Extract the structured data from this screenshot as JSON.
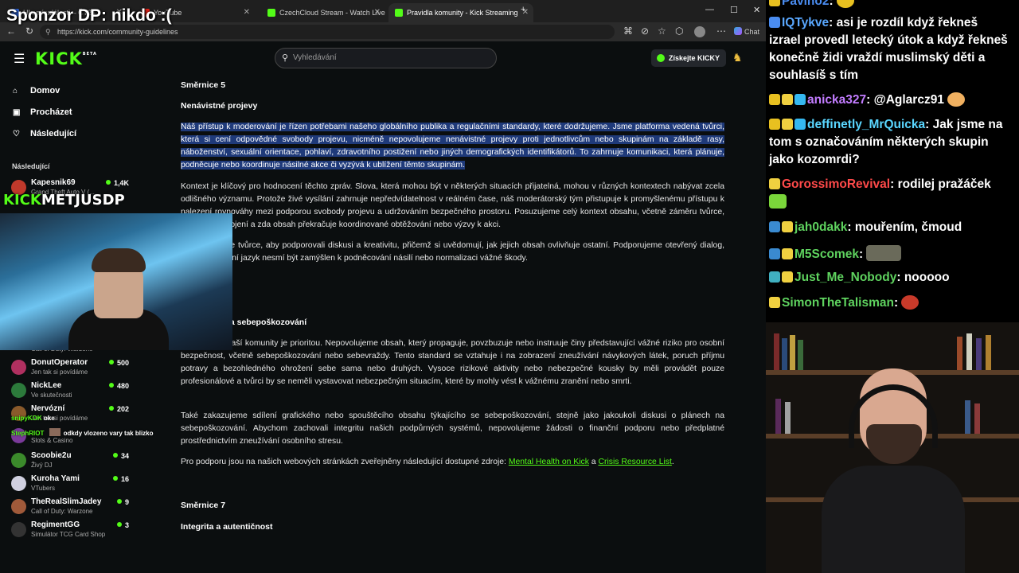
{
  "overlay": {
    "sponsor": "Sponzor DP: nikdo :(",
    "watermark_kick": "KICK",
    "watermark_name": "METJUSDP",
    "chat_line_user1": "snipyKOK",
    "chat_line_text1": "oke",
    "chat_line_user2": "StephRIOT",
    "chat_line_text2": "odkdy vlozeno vary tak blizko"
  },
  "browser": {
    "tabs": [
      {
        "label": "Hlavní události – ČT24"
      },
      {
        "label": "CzechCloud Stream - Watch Live o"
      },
      {
        "label": "Pravidla komunity - Kick Streaming"
      }
    ],
    "tab_youtube": "YouTube",
    "url": "https://kick.com/community-guidelines",
    "chat_btn": "Chat"
  },
  "kick": {
    "logo": "KICK",
    "logo_beta": "BETA",
    "search_placeholder": "Vyhledávání",
    "get_kicky": "Získejte KICKY",
    "nav": [
      {
        "label": "Domov",
        "icon": "home-icon"
      },
      {
        "label": "Procházet",
        "icon": "browse-icon"
      },
      {
        "label": "Následující",
        "icon": "heart-icon"
      }
    ],
    "following_header": "Následující",
    "channels": [
      {
        "name": "Kapesnik69",
        "game": "Grand Theft Auto V (...",
        "viewers": "1,4K",
        "color": "#c0392b"
      },
      {
        "name": "",
        "game": "Call of Duty: Warzone",
        "viewers": "",
        "color": "#555555"
      },
      {
        "name": "DonutOperator",
        "game": "Jen tak si povídáme",
        "viewers": "500",
        "color": "#b03060"
      },
      {
        "name": "NickLee",
        "game": "Ve skutečnosti",
        "viewers": "480",
        "color": "#2c7a3b"
      },
      {
        "name": "Nervózní",
        "game": "Jen tak si povídáme",
        "viewers": "202",
        "color": "#8a5a2b"
      },
      {
        "name": "",
        "game": "Slots & Casino",
        "viewers": "",
        "color": "#7a3a9a"
      },
      {
        "name": "Scoobie2u",
        "game": "Živý DJ",
        "viewers": "34",
        "color": "#3b8a2b"
      },
      {
        "name": "Kuroha Yami",
        "game": "VTubers",
        "viewers": "16",
        "color": "#d0d0e0"
      },
      {
        "name": "TheRealSlimJadey",
        "game": "Call of Duty: Warzone",
        "viewers": "9",
        "color": "#a05a3a"
      },
      {
        "name": "RegimentGG",
        "game": "Simulátor TCG Card Shop",
        "viewers": "3",
        "color": "#333333"
      }
    ],
    "content": {
      "h_smernice5": "Směrnice 5",
      "h_hate": "Nenávistné projevy",
      "p_hate": "Náš přístup k moderování je řízen potřebami našeho globálního publika a regulačními standardy, které dodržujeme. Jsme platforma vedená tvůrci, která si cení odpovědné svobody projevu, nicméně nepovolujeme nenávistné projevy proti jednotlivcům nebo skupinám na základě rasy, náboženství, sexuální orientace, pohlaví, zdravotního postižení nebo jiných demografických identifikátorů. To zahrnuje komunikaci, která plánuje, podněcuje nebo koordinuje násilné akce či vyzývá k ublížení těmto skupinám.",
      "p_context": "Kontext je klíčový pro hodnocení těchto zpráv. Slova, která mohou být v některých situacích přijatelná, mohou v různých kontextech nabývat zcela odlišného významu. Protože živé vysílání zahrnuje nepředvídatelnost v reálném čase, náš moderátorský tým přistupuje k promyšlenému přístupu k nalezení rovnováhy mezi podporou svobody projevu a udržováním bezpečného prostoru. Posuzujeme celý kontext obsahu, včetně záměru tvůrce, jeho míry zapojení a zda obsah překračuje koordinované obtěžování nebo výzvy k akci.",
      "p_encourage": "Povzbuzujeme tvůrce, aby podporovali diskusi a kreativitu, přičemž si uvědomují, jak jejich obsah ovlivňuje ostatní. Podporujeme otevřený dialog, ale provokativní jazyk nesmí být zamýšlen k podněcování násilí nebo normalizaci vážné škody.",
      "h_safety": "Bezpečnost a sebepoškozování",
      "p_safety": "Bezpečnost naší komunity je prioritou. Nepovolujeme obsah, který propaguje, povzbuzuje nebo instruuje činy představující vážné riziko pro osobní bezpečnost, včetně sebepoškozování nebo sebevraždy. Tento standard se vztahuje i na zobrazení zneužívání návykových látek, poruch příjmu potravy a bezohledného ohrožení sebe sama nebo druhých. Vysoce rizikové aktivity nebo nebezpečné kousky by měli provádět pouze profesionálové a tvůrci by se neměli vystavovat nebezpečným situacím, které by mohly vést k vážnému zranění nebo smrti.",
      "p_graphic": "Také zakazujeme sdílení grafického nebo spouštěcího obsahu týkajícího se sebepoškozování, stejně jako jakoukoli diskusi o plánech na sebepoškozování. Abychom zachovali integritu našich podpůrných systémů, nepovolujeme žádosti o finanční podporu nebo předplatné prostřednictvím zneužívání osobního stresu.",
      "p_support_pre": "Pro podporu jsou na našich webových stránkách zveřejněny následující dostupné zdroje: ",
      "link_mh": "Mental Health on Kick",
      "p_support_and": " a ",
      "link_crisis": "Crisis Resource List",
      "p_support_end": ".",
      "h_smernice7": "Směrnice 7",
      "h_integrity": "Integrita a autentičnost"
    }
  },
  "chat": {
    "messages": [
      {
        "user": "Pavino2",
        "user_color": "#4a8cf0",
        "text": ""
      },
      {
        "user": "IQTykve",
        "user_color": "#5aa8ff",
        "text": "asi je rozdíl když řekneš izrael provedl letecký útok a když řekneš konečně židi vraždí muslimský děti a souhlasíš s tím"
      },
      {
        "user": "anicka327",
        "user_color": "#c27cff",
        "text": "@Aglarcz91"
      },
      {
        "user": "deffinetly_MrQuicka",
        "user_color": "#5ad6ff",
        "text": "Jak jsme na tom s označováním některých skupin jako kozomrdi?"
      },
      {
        "user": "GorossimoRevival",
        "user_color": "#ff4a4a",
        "text": "rodilej pražáček"
      },
      {
        "user": "jah0dakk",
        "user_color": "#5fd35f",
        "text": "mouřením, čmoud"
      },
      {
        "user": "M5Scomek",
        "user_color": "#5fd35f",
        "text": ""
      },
      {
        "user": "Just_Me_Nobody",
        "user_color": "#5fd35f",
        "text": "nooooo"
      },
      {
        "user": "SimonTheTalisman",
        "user_color": "#5fd35f",
        "text": ""
      }
    ]
  },
  "colors": {
    "kick_green": "#53fc18",
    "highlight": "#1f3a7a",
    "bg": "#0b0e0f"
  }
}
